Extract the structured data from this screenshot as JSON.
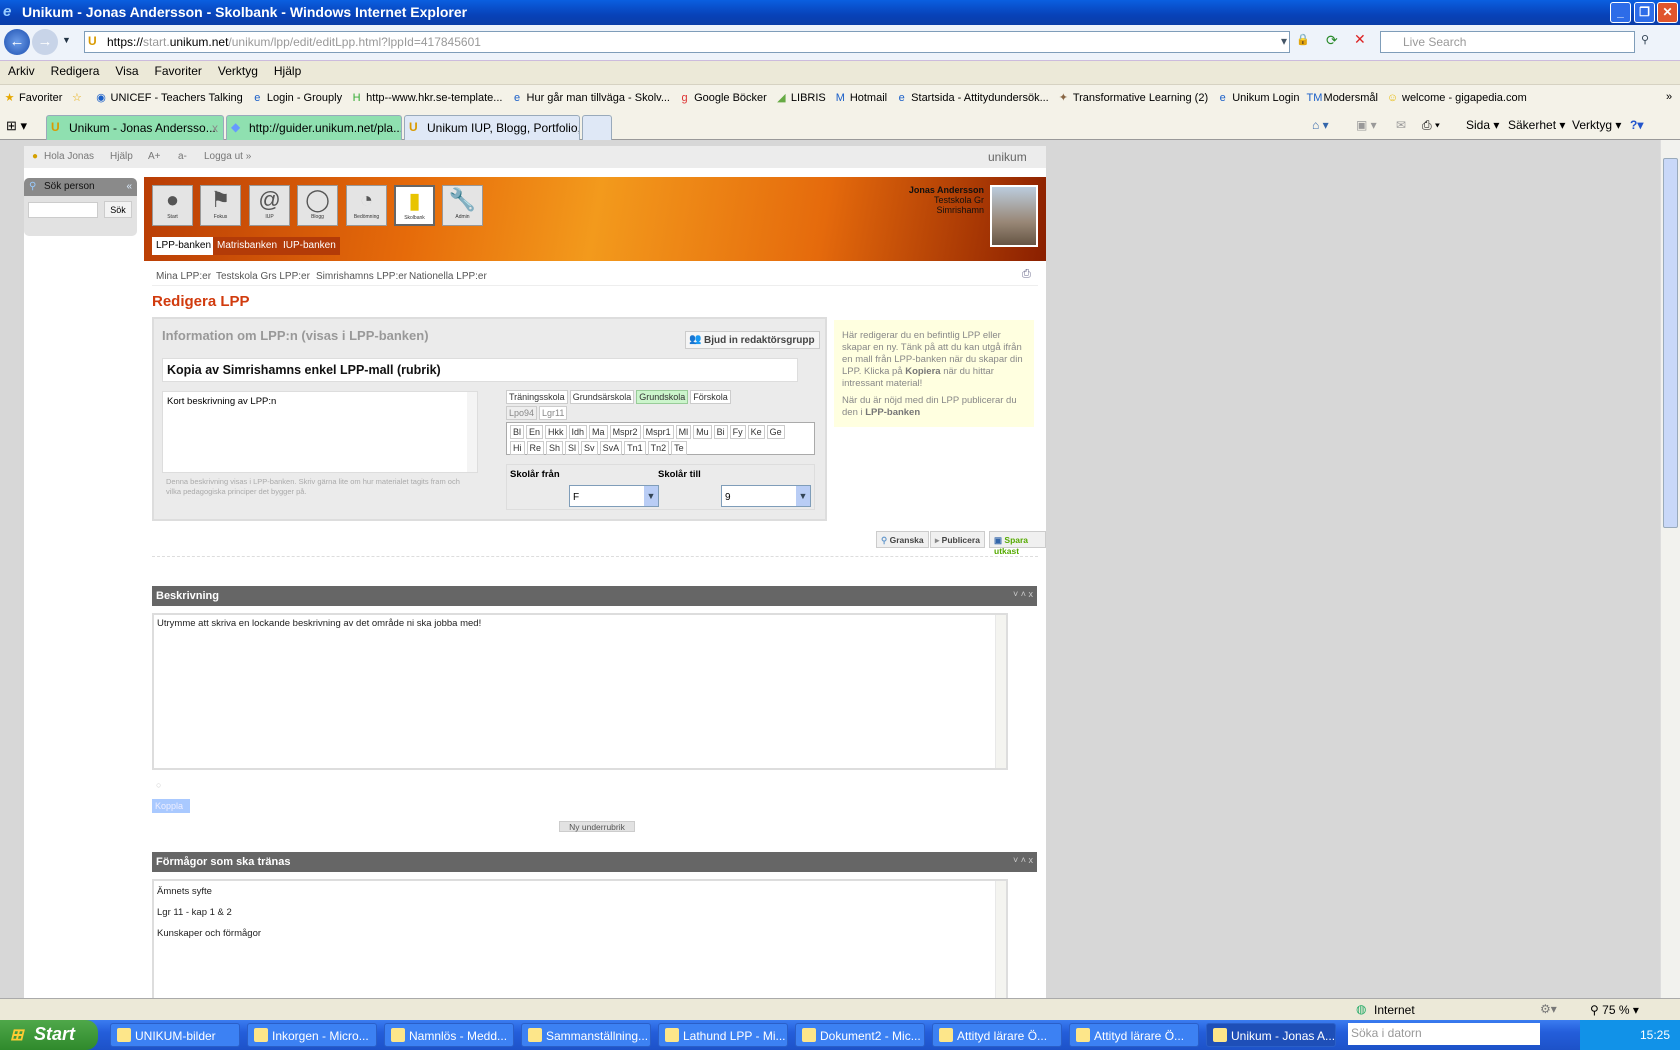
{
  "window": {
    "title": "Unikum - Jonas Andersson - Skolbank - Windows Internet Explorer"
  },
  "address": {
    "url_prefix": "https://",
    "url_host1": "start.",
    "url_host2": "unikum.net",
    "url_path": "/unikum/lpp/edit/editLpp.html?lppId=417845601",
    "search_placeholder": "Live Search"
  },
  "menu": [
    "Arkiv",
    "Redigera",
    "Visa",
    "Favoriter",
    "Verktyg",
    "Hjälp"
  ],
  "favorites": {
    "label": "Favoriter",
    "items": [
      "UNICEF - Teachers Talking",
      "Login - Grouply",
      "http--www.hkr.se-template...",
      "Hur går man tillväga - Skolv...",
      "Google Böcker",
      "LIBRIS",
      "Hotmail",
      "Startsida - Attitydundersök...",
      "Transformative Learning (2)",
      "Unikum Login",
      "Modersmål",
      "welcome - gigapedia.com"
    ]
  },
  "tabs": [
    "Unikum - Jonas Andersso...",
    "http://guider.unikum.net/pla...",
    "Unikum IUP, Blogg, Portfolio,..."
  ],
  "commandbar": [
    "Sida",
    "Säkerhet",
    "Verktyg"
  ],
  "page": {
    "topline": {
      "greeting": "Hola Jonas",
      "help": "Hjälp",
      "font_up": "A+",
      "font_down": "a-",
      "logout": "Logga ut »",
      "logo": "unikum"
    },
    "sidebar": {
      "title": "Sök person",
      "search_button": "Sök",
      "collapse": "«"
    },
    "icons": [
      {
        "label": "Start",
        "glyph": "●"
      },
      {
        "label": "Fokus",
        "glyph": "⚑"
      },
      {
        "label": "IUP",
        "glyph": "@"
      },
      {
        "label": "Blogg",
        "glyph": "💬"
      },
      {
        "label": "Bedömning",
        "glyph": "◔"
      },
      {
        "label": "Skolbank",
        "glyph": "▮"
      },
      {
        "label": "Admin",
        "glyph": "🔧"
      }
    ],
    "user": {
      "name": "Jonas Andersson",
      "school": "Testskola Gr",
      "municipality": "Simrishamn"
    },
    "bank_tabs": [
      "LPP-banken",
      "Matrisbanken",
      "IUP-banken"
    ],
    "subnav": [
      "Mina LPP:er",
      "Testskola Grs LPP:er",
      "Simrishamns LPP:er",
      "Nationella LPP:er"
    ],
    "heading": "Redigera LPP",
    "info": {
      "title": "Information om LPP:n (visas i LPP-banken)",
      "invite_button": "Bjud in redaktörsgrupp",
      "rubric": "Kopia av Simrishamns enkel LPP-mall (rubrik)",
      "short_desc": "Kort beskrivning av LPP:n",
      "hint": "Denna beskrivning visas i LPP-banken. Skriv gärna lite om hur materialet tagits fram och vilka pedagogiska principer det bygger på.",
      "school_forms": [
        "Träningsskola",
        "Grundsärskola",
        "Grundskola",
        "Förskola"
      ],
      "selected_school_form": "Grundskola",
      "curricula": [
        "Lpo94",
        "Lgr11"
      ],
      "subjects_row1": [
        "Bl",
        "En",
        "Hkk",
        "Idh",
        "Ma",
        "Mspr2",
        "Mspr1",
        "Ml",
        "Mu",
        "Bi",
        "Fy",
        "Ke",
        "Ge"
      ],
      "subjects_row2": [
        "Hi",
        "Re",
        "Sh",
        "Sl",
        "Sv",
        "SvA",
        "Tn1",
        "Tn2",
        "Te"
      ],
      "year_from_label": "Skolår från",
      "year_from": "F",
      "year_to_label": "Skolår till",
      "year_to": "9"
    },
    "note": {
      "p1a": "Här redigerar du en befintlig LPP eller skapar en ny. Tänk på att du kan utgå ifrån en mall från LPP-banken när du skapar din LPP. Klicka på ",
      "p1b": "Kopiera",
      "p1c": " när du hittar intressant material!",
      "p2a": "När du är nöjd med din LPP publicerar du den i ",
      "p2b": "LPP-banken"
    },
    "actions": {
      "review": "Granska",
      "publish": "Publicera",
      "save_draft": "Spara utkast"
    },
    "section1": {
      "title": "Beskrivning",
      "text": "Utrymme att skriva en lockande beskrivning av det område ni ska jobba med!",
      "connect": "Koppla",
      "new_subheading": "Ny underrubrik"
    },
    "section2": {
      "title": "Förmågor som ska tränas",
      "lines": [
        "Ämnets syfte",
        "Lgr 11 - kap 1 & 2",
        "Kunskaper och förmågor"
      ]
    },
    "section_controls": "˅ ˄ x"
  },
  "status": {
    "zone": "Internet",
    "zoom": "75 %"
  },
  "taskbar": {
    "start": "Start",
    "items": [
      "UNIKUM-bilder",
      "Inkorgen - Micro...",
      "Namnlös - Medd...",
      "Sammanställning...",
      "Lathund LPP - Mi...",
      "Dokument2 - Mic...",
      "Attityd lärare Ö...",
      "Attityd lärare Ö...",
      "Unikum - Jonas A..."
    ],
    "search_placeholder": "Söka i datorn",
    "clock": "15:25"
  },
  "colors": {
    "accent": "#d13b0e",
    "section_header": "#666666",
    "selected_chip": "#ccf5cc",
    "note_bg": "#ffffe0"
  }
}
